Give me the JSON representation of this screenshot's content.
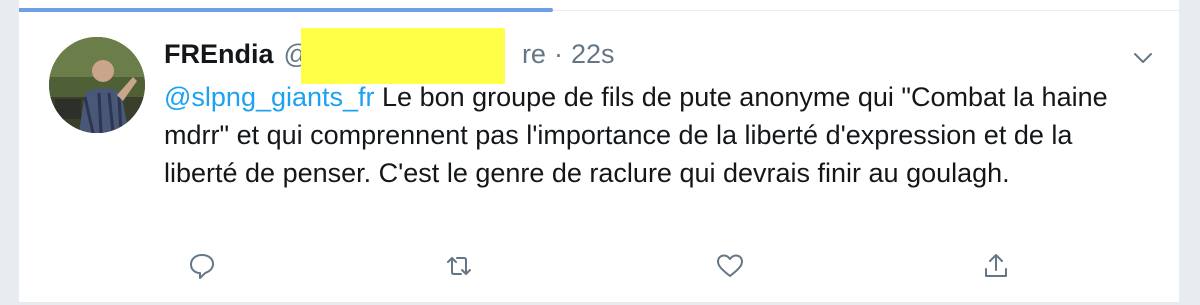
{
  "tweet": {
    "display_name": "FREndia",
    "handle_visible_start": "@",
    "handle_visible_end": "re",
    "separator": "·",
    "timestamp": "22s",
    "mention": "@slpng_giants_fr",
    "text": " Le bon groupe de fils de pute anonyme qui \"Combat la haine mdrr\" et qui comprennent pas l'importance de la liberté d'expression et de la liberté de penser. C'est le genre de raclure qui devrais finir au goulagh."
  },
  "loading_progress": 0.46,
  "icons": {
    "caret": "chevron-down-icon",
    "reply": "reply-icon",
    "retweet": "retweet-icon",
    "like": "heart-icon",
    "share": "share-icon",
    "redaction": "yellow-redaction-box"
  },
  "colors": {
    "link": "#1da1f2",
    "muted": "#657786",
    "progress": "#6c9fe3",
    "redaction": "#ffff47"
  }
}
